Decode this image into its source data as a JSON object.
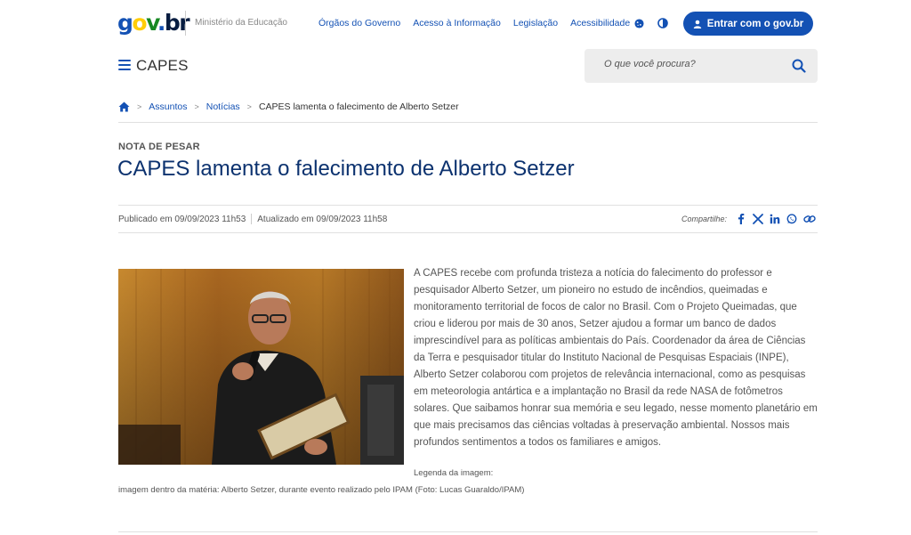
{
  "header": {
    "logo": {
      "g": "g",
      "o": "o",
      "v": "v",
      "dot": ".",
      "br": "br"
    },
    "ministry": "Ministério da Educação",
    "links": [
      "Órgãos do Governo",
      "Acesso à Informação",
      "Legislação",
      "Acessibilidade"
    ],
    "login_label": "Entrar com o gov.br",
    "site_name": "CAPES",
    "search_placeholder": "O que você procura?"
  },
  "breadcrumb": {
    "items": [
      "Assuntos",
      "Notícias"
    ],
    "current": "CAPES lamenta o falecimento de Alberto Setzer",
    "separator": ">"
  },
  "article": {
    "kicker": "NOTA DE PESAR",
    "title": "CAPES lamenta o falecimento de Alberto Setzer",
    "published": "Publicado em 09/09/2023 11h53",
    "updated": "Atualizado em 09/09/2023 11h58",
    "share_label": "Compartilhe:",
    "body": "A CAPES recebe com profunda tristeza a notícia do falecimento do professor e pesquisador Alberto Setzer, um pioneiro no estudo de incêndios, queimadas e monitoramento territorial de focos de calor no Brasil. Com o Projeto Queimadas, que criou e liderou por mais de 30 anos, Setzer ajudou a formar um banco de dados imprescindível para as políticas ambientais do País. Coordenador da área de Ciências da Terra e pesquisador titular do Instituto Nacional de Pesquisas Espaciais (INPE), Alberto Setzer colaborou com projetos de relevância internacional, como as pesquisas em meteorologia antártica e a implantação no Brasil da rede NASA de fotômetros solares. Que saibamos honrar sua memória e seu legado, nesse momento planetário em que mais precisamos das ciências voltadas à preservação ambiental. Nossos mais profundos sentimentos a todos os familiares e amigos.",
    "caption_label": "Legenda da imagem:",
    "caption": "imagem dentro da matéria: Alberto Setzer, durante evento realizado pelo IPAM (Foto: Lucas Guaraldo/IPAM)"
  },
  "colors": {
    "primary": "#1351b4",
    "title": "#0c326f",
    "logo_yellow": "#ffcd07",
    "logo_green": "#168821"
  }
}
